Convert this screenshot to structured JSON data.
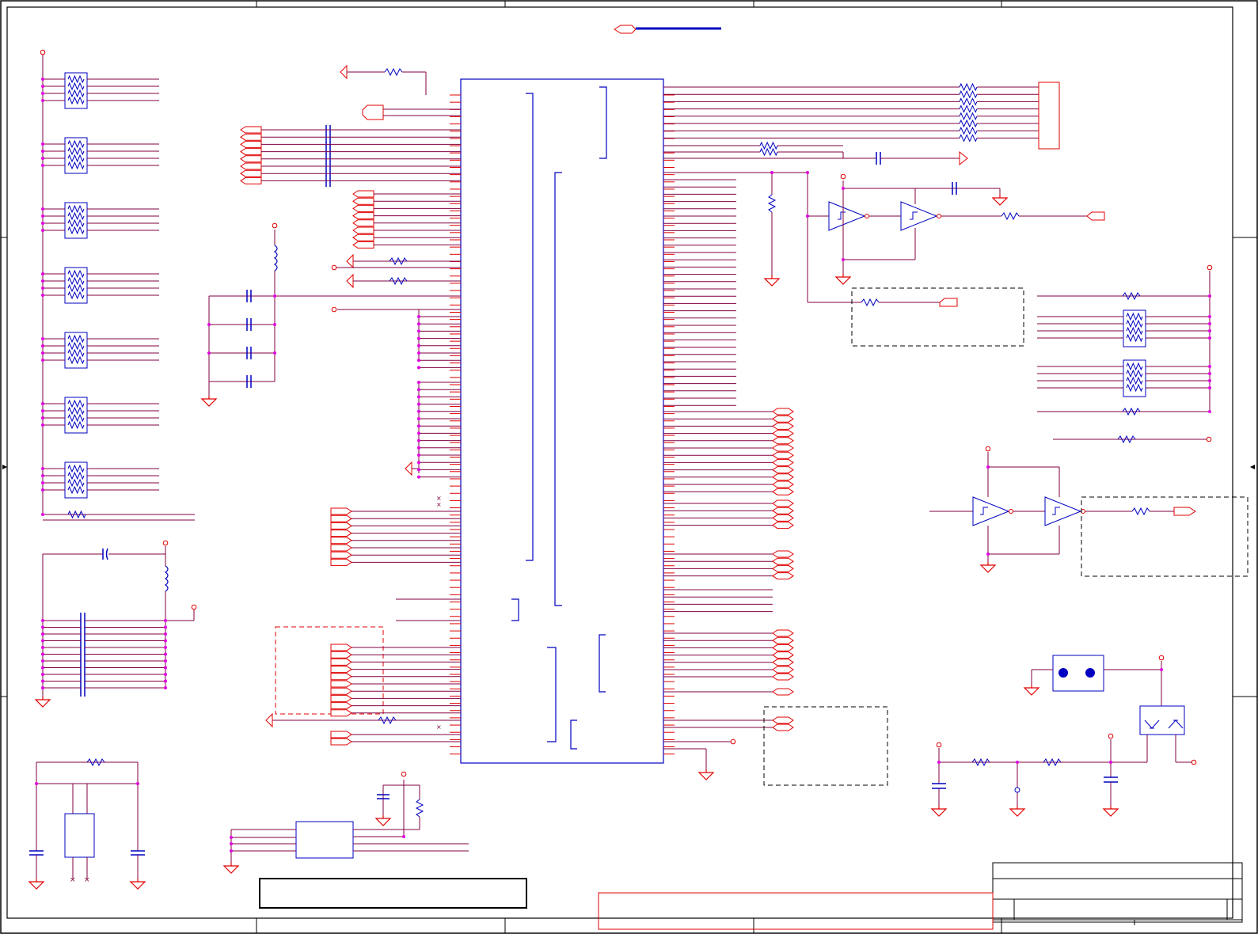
{
  "sheet": {
    "title": "",
    "doc_number": "",
    "revision": "",
    "sheet_of": ""
  },
  "colors": {
    "border": "#000000",
    "wire": "#800040",
    "net": "#e00000",
    "component": "#0000c0",
    "junction": "#e000e0",
    "note_box": "#000000",
    "note_box_red": "#e00000"
  },
  "grid_zones": {
    "columns": [
      "",
      "",
      "",
      "",
      ""
    ],
    "rows": [
      "",
      "",
      ""
    ]
  }
}
